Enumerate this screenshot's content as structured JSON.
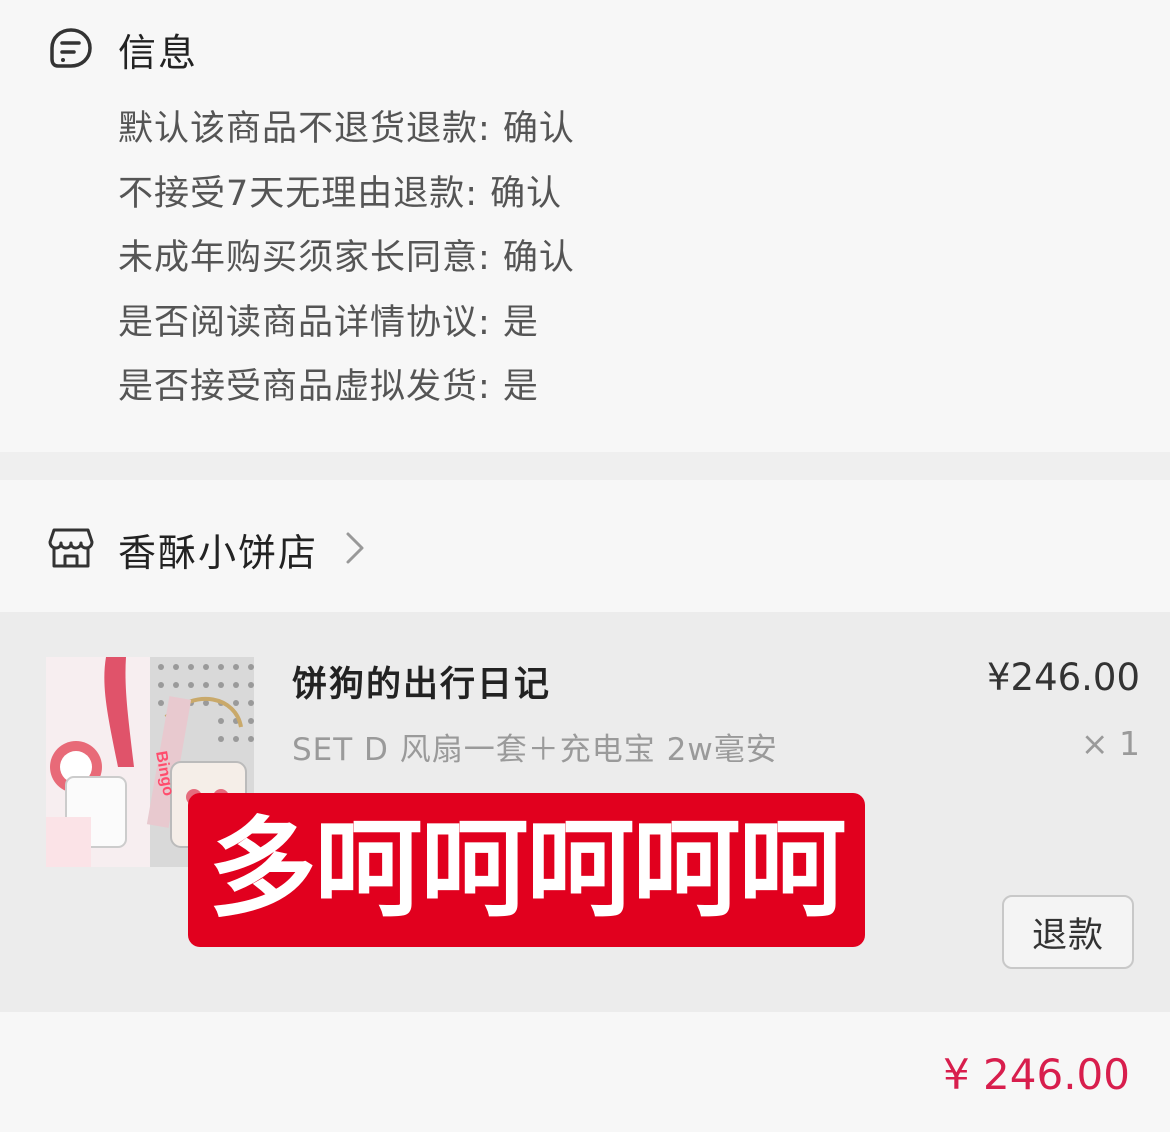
{
  "info": {
    "title": "信息",
    "lines": [
      "默认该商品不退货退款: 确认",
      "不接受7天无理由退款: 确认",
      "未成年购买须家长同意: 确认",
      "是否阅读商品详情协议: 是",
      "是否接受商品虚拟发货: 是"
    ]
  },
  "store": {
    "name": "香酥小饼店",
    "icon": "store-icon"
  },
  "product": {
    "name": "饼狗的出行日记",
    "variant": "SET D  风扇一套＋充电宝 2w毫安",
    "price": "¥246.00",
    "quantity": "× 1",
    "thumbnail_text": "Bingo",
    "refund_label": "退款"
  },
  "overlay": {
    "text": "多呵呵呵呵呵",
    "color": "#e1001e"
  },
  "total": {
    "price": "¥ 246.00",
    "color": "#d81e4d"
  }
}
